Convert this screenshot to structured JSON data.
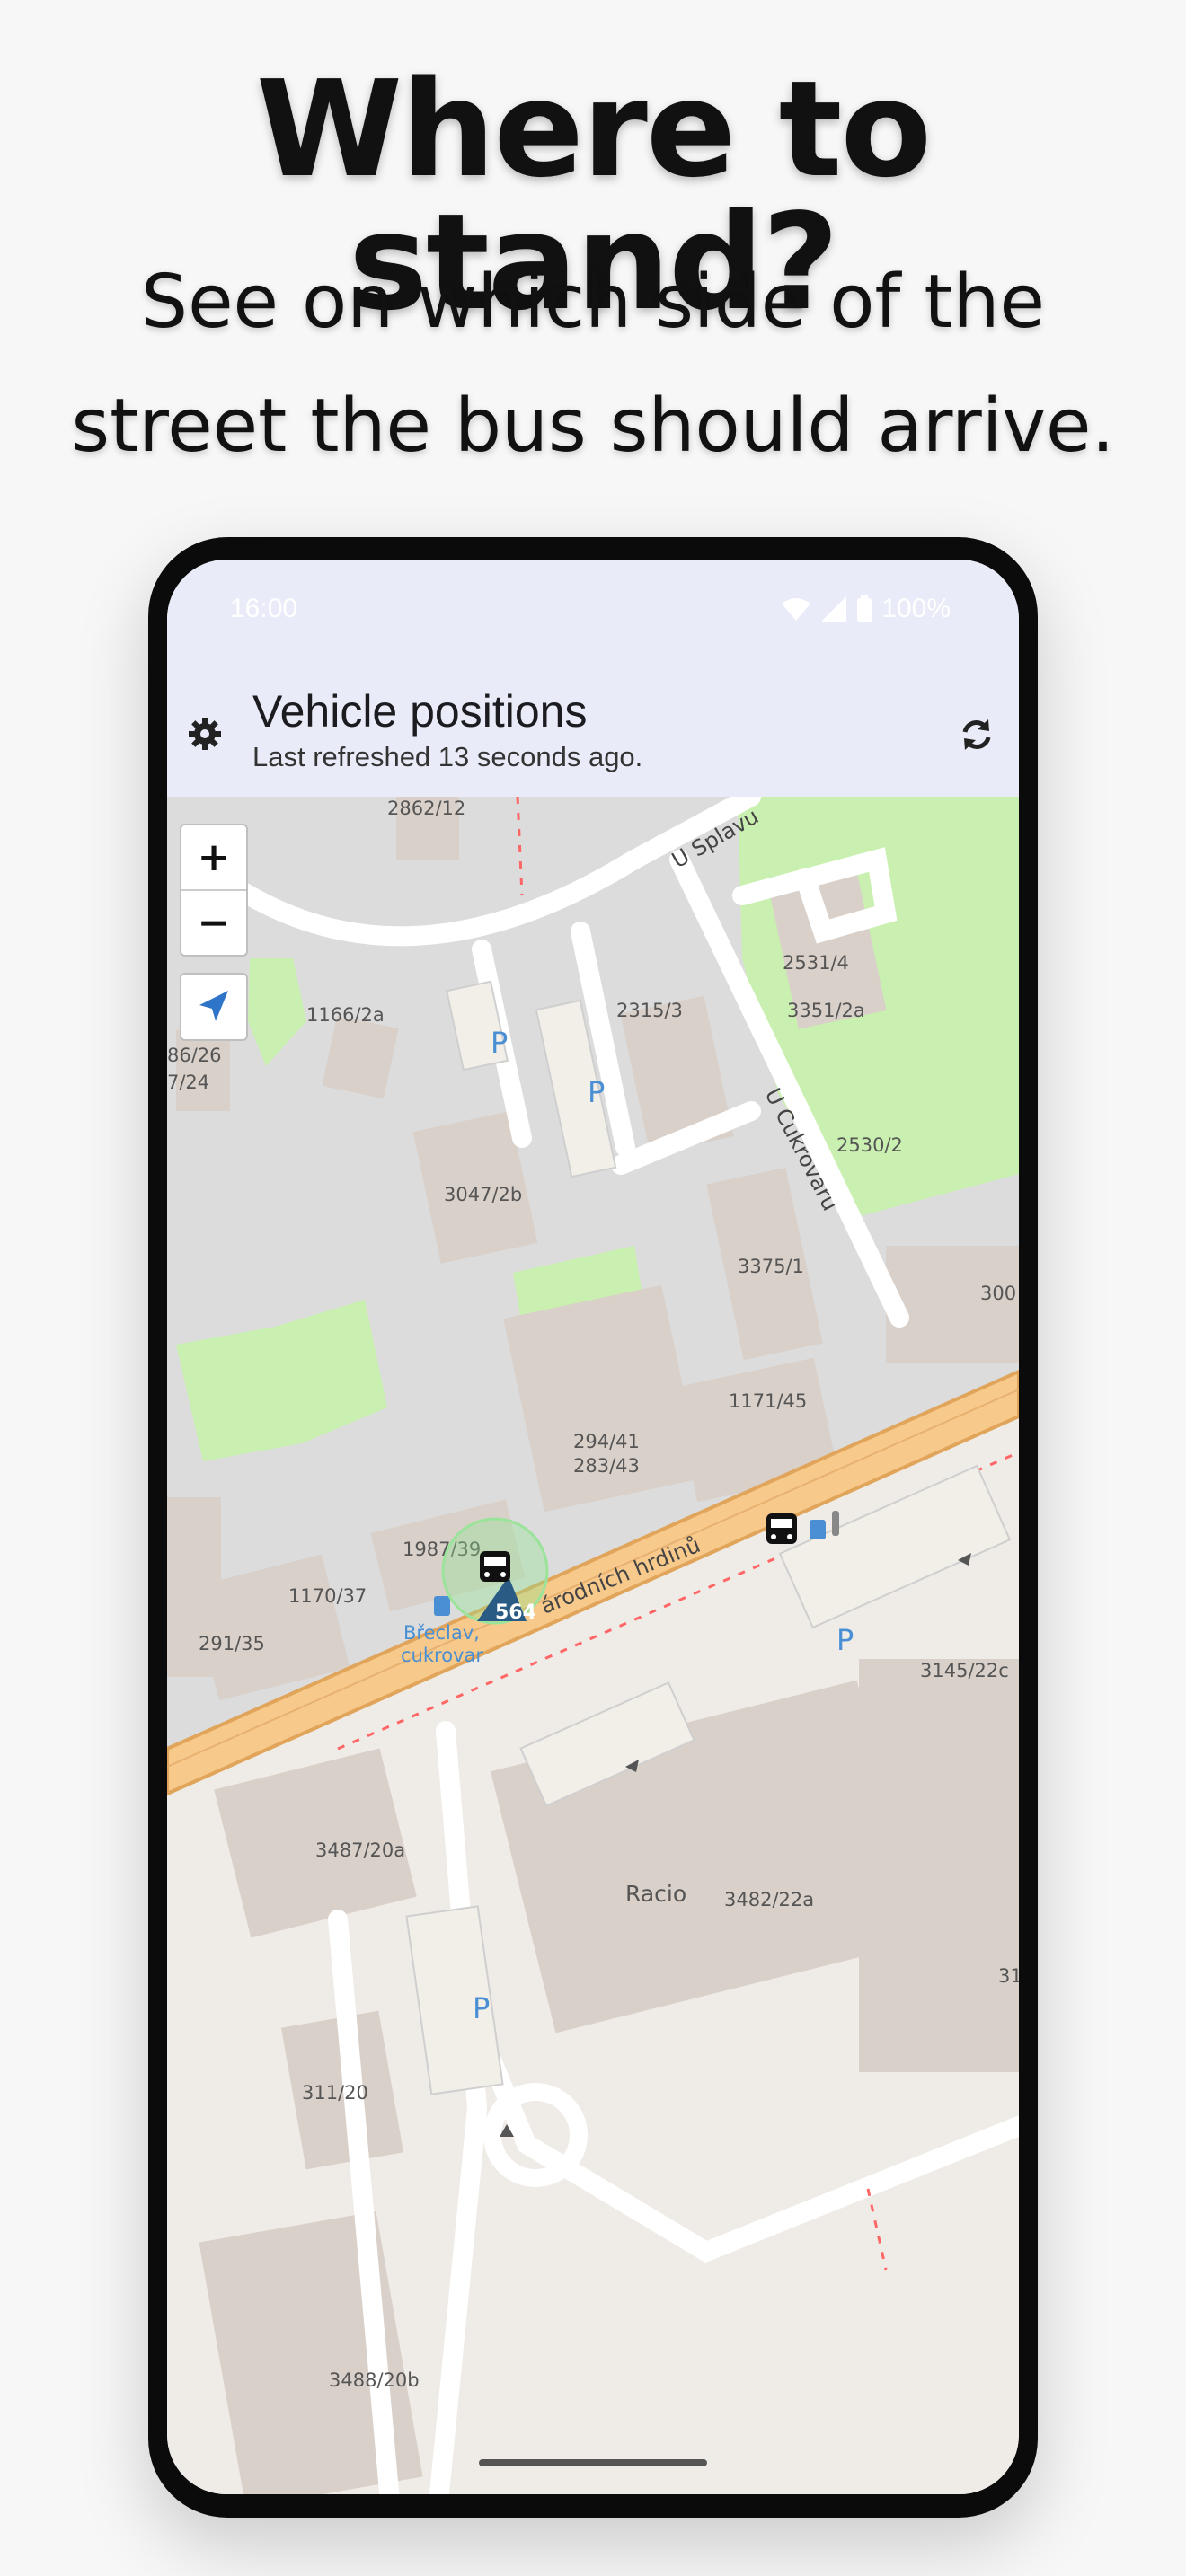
{
  "promo": {
    "headline": "Where to stand?",
    "subline_1": "See on which side of the",
    "subline_2": "street the bus should arrive."
  },
  "status_bar": {
    "time": "16:00",
    "battery": "100%"
  },
  "app_bar": {
    "title": "Vehicle positions",
    "subtitle": "Last refreshed 13 seconds ago."
  },
  "map": {
    "zoom_in": "+",
    "zoom_out": "−",
    "streets": [
      "U Splavu",
      "U Cukrovaru",
      "Národních hrdinů"
    ],
    "street_label_main": "árodních hrdinů",
    "buildings": [
      "2862/12",
      "1166/2a",
      "2315/3",
      "2531/4",
      "3351/2a",
      "2530/2",
      "3047/2b",
      "3375/1",
      "300",
      "1171/45",
      "294/41",
      "283/43",
      "1987/39",
      "1170/37",
      "291/35",
      "3145/22c",
      "3487/20a",
      "Racio",
      "3482/22a",
      "311/20",
      "3488/20b",
      "86/26",
      "7/24",
      "31"
    ],
    "parking_label": "P",
    "stop_name_1": "Břeclav,",
    "stop_name_2": "cukrovar",
    "vehicle_line": "564"
  },
  "colors": {
    "map_bg": "#efebe6",
    "building": "#d9d0c9",
    "built_area": "#dddddd",
    "green": "#c9f0b0",
    "main_road": "#f7c98b",
    "parking": "#f2efe9",
    "bus_stop_blue": "#4a8fd3",
    "vehicle_marker": "#2a5b84",
    "appbar_bg": "#e9ecf8"
  }
}
